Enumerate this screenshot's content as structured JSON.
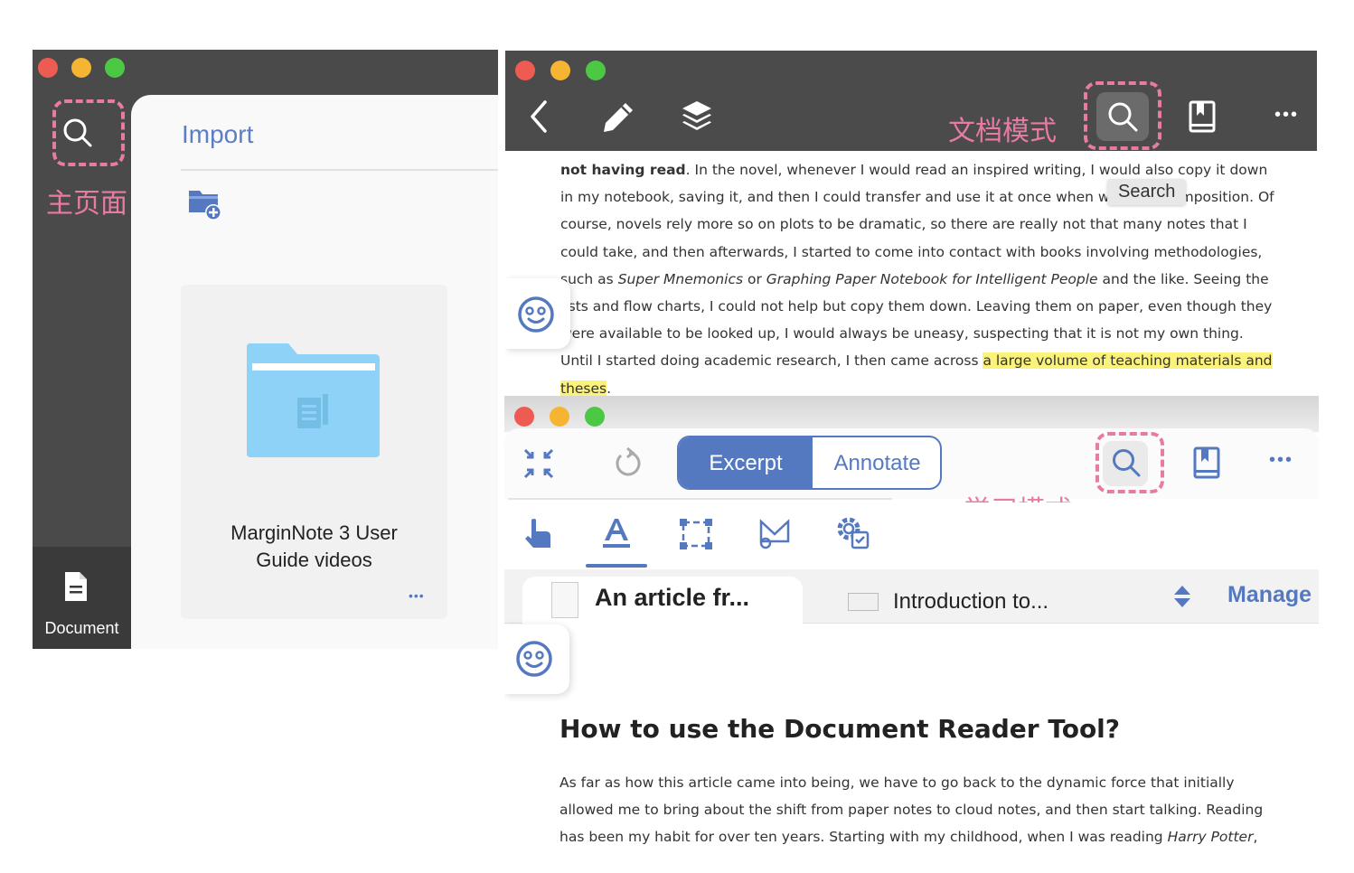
{
  "home": {
    "label_cn": "主页面",
    "import_label": "Import",
    "folder_title_line1": "MarginNote 3 User",
    "folder_title_line2": "Guide videos",
    "more": "•••",
    "bottom_tab_label": "Document"
  },
  "doc_mode": {
    "label_cn": "文档模式",
    "tooltip": "Search",
    "more": "•••",
    "paragraph": [
      {
        "b": "not having read"
      },
      {
        "t": ". In the novel, whenever I would read an inspired writing, I would also copy it down in my notebook, saving it, and then I could transfer and use it at once when writing a composition. Of course, novels rely more so on plots to be dramatic, so there are really not that many notes that I could take, and then afterwards, I started to come into contact with books involving methodologies, such as "
      },
      {
        "i": "Super Mnemonics"
      },
      {
        "t": " or "
      },
      {
        "i": "Graphing Paper Notebook for Intelligent People"
      },
      {
        "t": " and the like. Seeing the lists and flow charts, I could not help but copy them down. Leaving them on paper, even though they were available to be looked up, I would always be uneasy, suspecting that it is not my own thing. Until I started doing academic research, I then came across "
      },
      {
        "h": "a large volume of teaching materials and theses"
      },
      {
        "t": "."
      }
    ]
  },
  "study_mode": {
    "label_cn": "学习模式",
    "segment_excerpt": "Excerpt",
    "segment_annotate": "Annotate",
    "more": "•••",
    "tab1": "An article fr...",
    "tab2": "Introduction to...",
    "manage": "Manage",
    "heading": "How to use the Document Reader Tool?",
    "body_line1": "As far as how this article came into being, we have to go back to the dynamic force that initially",
    "body_line2": "allowed me to bring about the shift from paper notes to cloud notes, and then start talking. Reading",
    "body_line3_pre": "has been my habit for over ten years. Starting with my childhood, when I was reading ",
    "body_line3_italic": "Harry Potter",
    "body_line3_post": ","
  },
  "colors": {
    "toolbar_dark": "#4b4b4b",
    "accent_blue": "#5479c0",
    "annotation_pink": "#e87ba4",
    "highlight_yellow": "#fbf27a"
  }
}
